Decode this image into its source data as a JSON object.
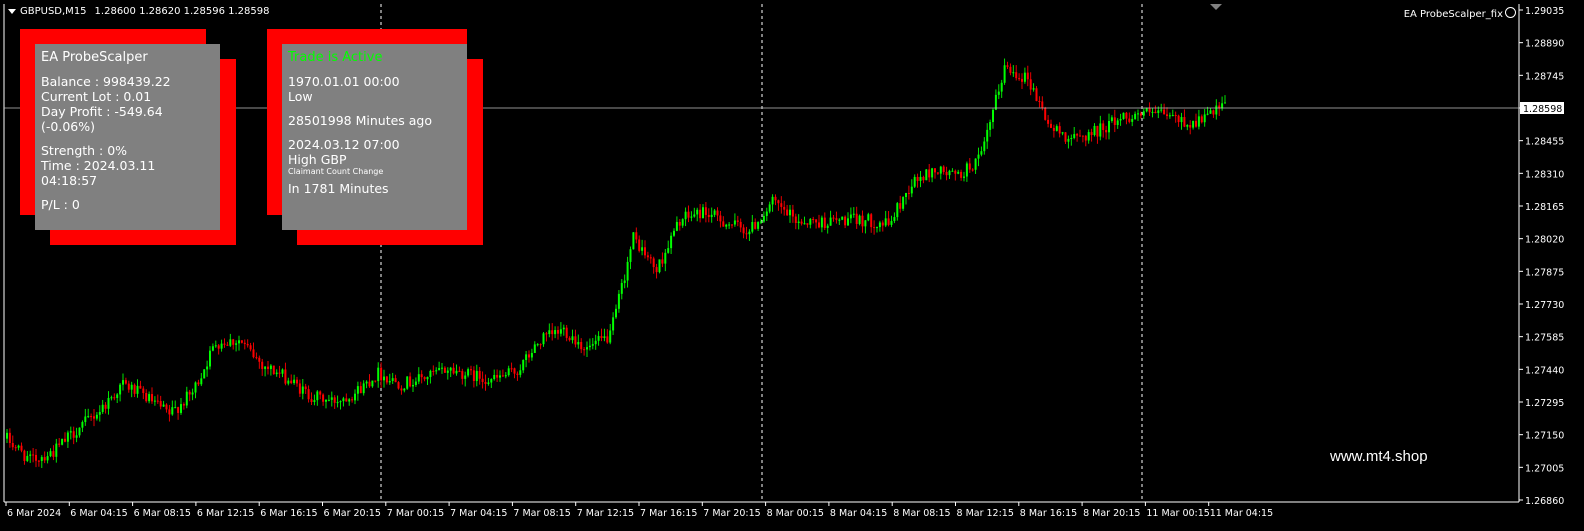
{
  "header": {
    "symbol": "GBPUSD,M15",
    "ohlc": "1.28600 1.28620 1.28596 1.28598"
  },
  "ea_label": "EA ProbeScalper_fix",
  "watermark": "www.mt4.shop",
  "panel_left": {
    "title": "EA ProbeScalper",
    "balance": "Balance : 998439.22",
    "lot": "Current Lot : 0.01",
    "profit": "Day Profit : -549.64 (-0.06%)",
    "strength": "Strength : 0%",
    "time": "Time : 2024.03.11 04:18:57",
    "pl": "P/L : 0"
  },
  "panel_right": {
    "status": "Trade is Active",
    "date1": "1970.01.01 00:00",
    "level": "Low",
    "ago": "28501998 Minutes ago",
    "date2": "2024.03.12 07:00",
    "impact": "High GBP",
    "event": "Claimant Count Change",
    "in": "In 1781 Minutes"
  },
  "colors": {
    "bull": "#00ff00",
    "bear": "#ff0000",
    "panel_bg": "#808080",
    "panel_frame": "#ff0000",
    "active_text": "#00ff00"
  },
  "chart_data": {
    "type": "candlestick",
    "symbol": "GBPUSD",
    "timeframe": "M15",
    "current_price": "1.28598",
    "ylim": [
      1.2679,
      1.2907
    ],
    "y_ticks": [
      "1.29035",
      "1.28890",
      "1.28745",
      "1.28598",
      "1.28455",
      "1.28310",
      "1.28165",
      "1.28020",
      "1.27875",
      "1.27730",
      "1.27585",
      "1.27440",
      "1.27295",
      "1.27150",
      "1.27005",
      "1.26860"
    ],
    "x_ticks": [
      "6 Mar 2024",
      "6 Mar 04:15",
      "6 Mar 08:15",
      "6 Mar 12:15",
      "6 Mar 16:15",
      "6 Mar 20:15",
      "7 Mar 00:15",
      "7 Mar 04:15",
      "7 Mar 08:15",
      "7 Mar 12:15",
      "7 Mar 16:15",
      "7 Mar 20:15",
      "8 Mar 00:15",
      "8 Mar 04:15",
      "8 Mar 08:15",
      "8 Mar 12:15",
      "8 Mar 16:15",
      "8 Mar 20:15",
      "11 Mar 00:15",
      "11 Mar 04:15"
    ],
    "day_separators": [
      "7 Mar 2024",
      "8 Mar 2024",
      "11 Mar 2024"
    ],
    "price_path": [
      [
        0,
        1.2708
      ],
      [
        8,
        1.2698
      ],
      [
        16,
        1.2702
      ],
      [
        24,
        1.2712
      ],
      [
        32,
        1.2721
      ],
      [
        40,
        1.2733
      ],
      [
        48,
        1.2727
      ],
      [
        56,
        1.2719
      ],
      [
        64,
        1.2729
      ],
      [
        72,
        1.2752
      ],
      [
        80,
        1.2753
      ],
      [
        88,
        1.2742
      ],
      [
        96,
        1.2736
      ],
      [
        104,
        1.2728
      ],
      [
        112,
        1.2725
      ],
      [
        120,
        1.2729
      ],
      [
        128,
        1.2738
      ],
      [
        136,
        1.2733
      ],
      [
        144,
        1.2736
      ],
      [
        152,
        1.274
      ],
      [
        160,
        1.2737
      ],
      [
        168,
        1.2735
      ],
      [
        176,
        1.2739
      ],
      [
        184,
        1.2753
      ],
      [
        192,
        1.2758
      ],
      [
        200,
        1.2749
      ],
      [
        208,
        1.2755
      ],
      [
        216,
        1.28
      ],
      [
        224,
        1.2785
      ],
      [
        232,
        1.2808
      ],
      [
        240,
        1.2812
      ],
      [
        248,
        1.2807
      ],
      [
        256,
        1.2803
      ],
      [
        264,
        1.2816
      ],
      [
        272,
        1.2808
      ],
      [
        280,
        1.2807
      ],
      [
        288,
        1.2808
      ],
      [
        296,
        1.2808
      ],
      [
        304,
        1.2806
      ],
      [
        312,
        1.2825
      ],
      [
        320,
        1.2831
      ],
      [
        328,
        1.2828
      ],
      [
        336,
        1.2837
      ],
      [
        344,
        1.2878
      ],
      [
        352,
        1.2873
      ],
      [
        360,
        1.285
      ],
      [
        368,
        1.2845
      ],
      [
        376,
        1.2849
      ],
      [
        384,
        1.2855
      ],
      [
        392,
        1.2857
      ],
      [
        400,
        1.2856
      ],
      [
        408,
        1.2852
      ],
      [
        416,
        1.2857
      ],
      [
        420,
        1.286
      ]
    ]
  }
}
